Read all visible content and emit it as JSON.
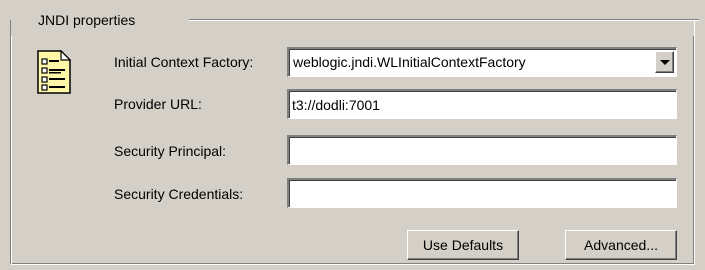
{
  "group": {
    "legend": "JNDI properties"
  },
  "icon": {
    "name": "properties-document-icon"
  },
  "fields": {
    "initial_context_factory": {
      "label": "Initial Context Factory:",
      "value": "weblogic.jndi.WLInitialContextFactory"
    },
    "provider_url": {
      "label": "Provider URL:",
      "value": "t3://dodli:7001"
    },
    "security_principal": {
      "label": "Security Principal:",
      "value": ""
    },
    "security_credentials": {
      "label": "Security Credentials:",
      "value": ""
    }
  },
  "buttons": {
    "use_defaults": "Use Defaults",
    "advanced": "Advanced..."
  },
  "colors": {
    "window_background": "#d4d0c8",
    "field_background": "#ffffff",
    "icon_fill": "#fff7a8"
  }
}
